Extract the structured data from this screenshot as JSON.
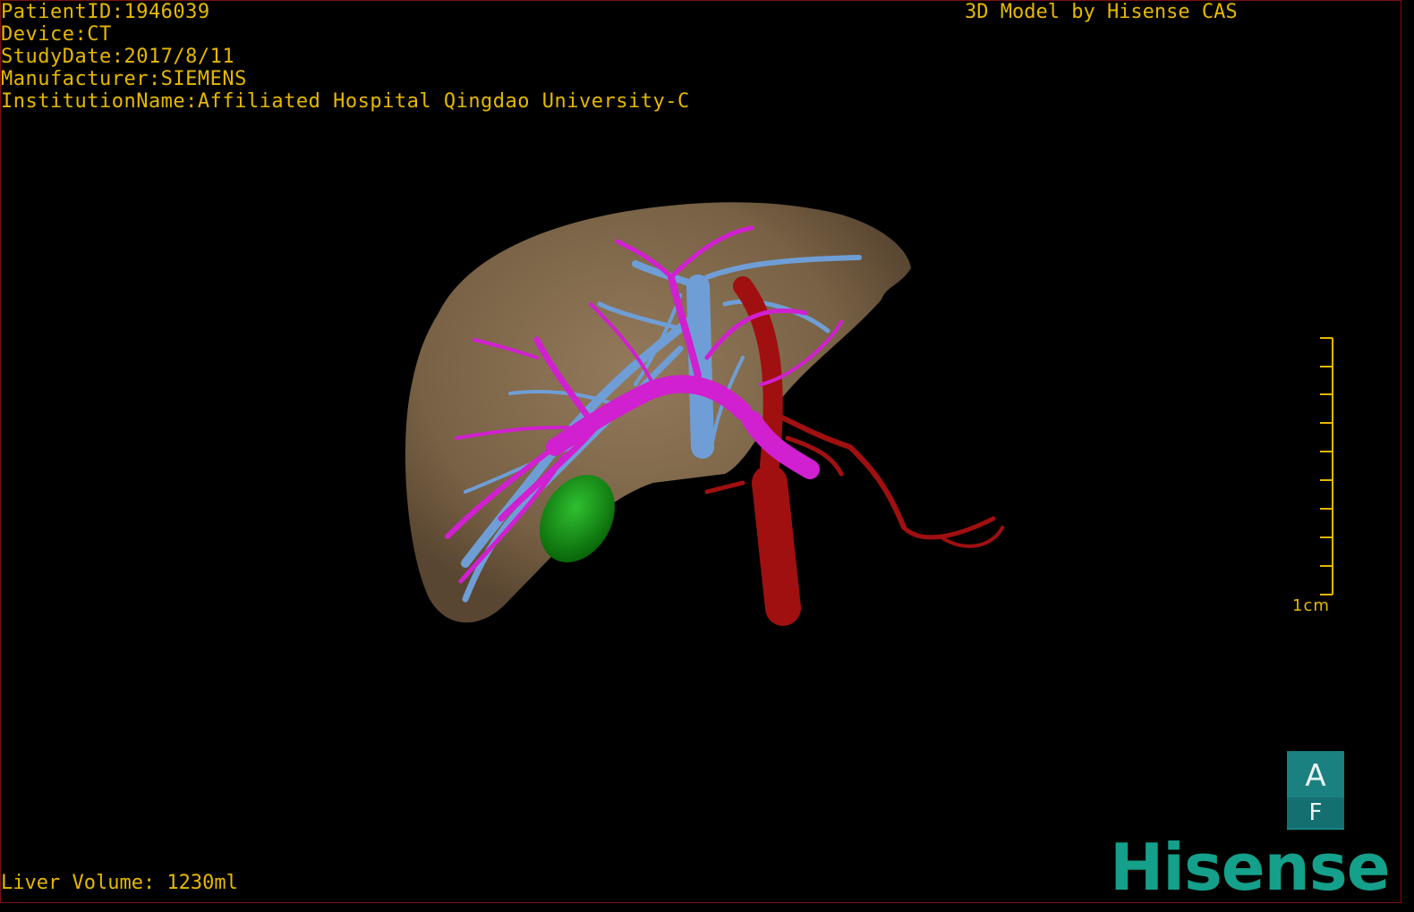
{
  "overlay": {
    "patient_id": "PatientID:1946039",
    "device": "Device:CT",
    "study_date": "StudyDate:2017/8/11",
    "manufacturer": "Manufacturer:SIEMENS",
    "institution": "InstitutionName:Affiliated Hospital Qingdao University-C",
    "credit": "3D Model by Hisense CAS",
    "liver_volume": "Liver Volume: 1230ml"
  },
  "scale": {
    "label": "1cm"
  },
  "orientation": {
    "top": "A",
    "bottom": "F"
  },
  "brand": {
    "name": "Hisense"
  },
  "colors": {
    "overlay_text": "#e6b800",
    "liver": "#8a7050",
    "portal_vein": "#d020d0",
    "hepatic_vein": "#6f9ed6",
    "artery": "#a01010",
    "gallbladder": "#18a018",
    "brand": "#14a08a",
    "orientation_box": "#1a8080"
  }
}
